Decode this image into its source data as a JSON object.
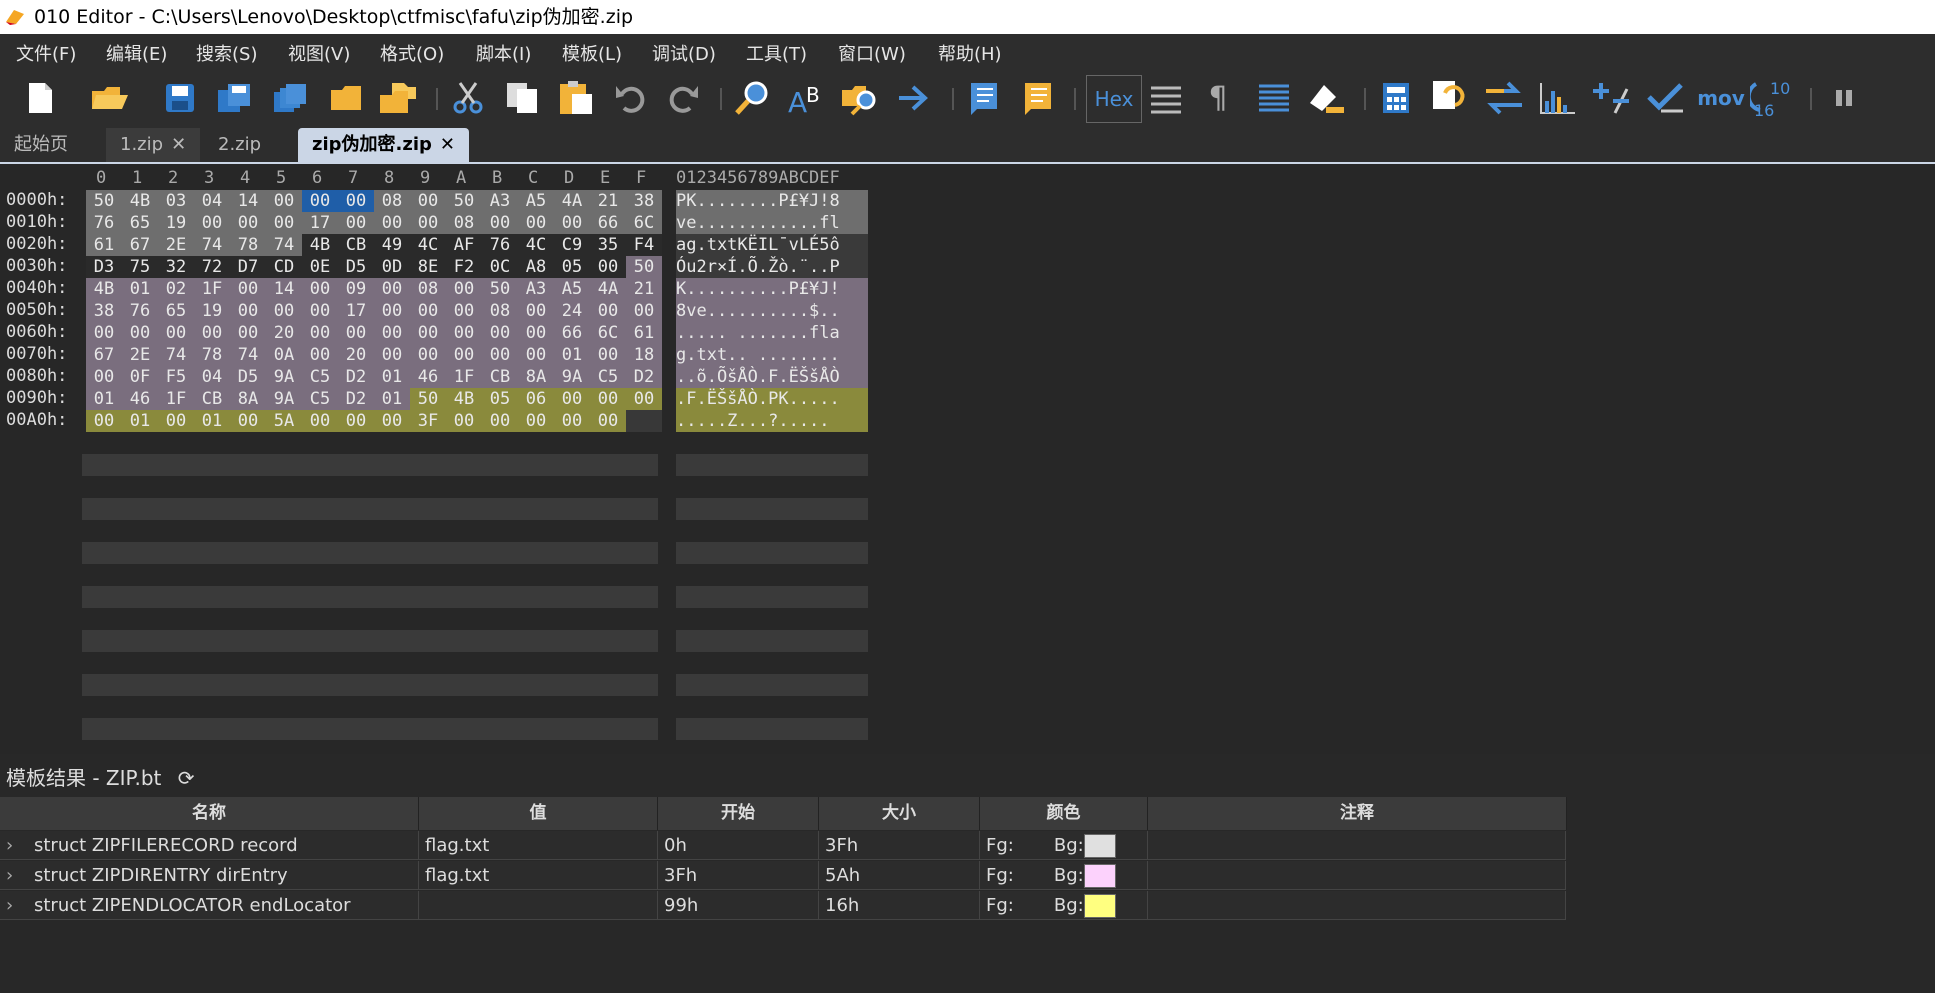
{
  "window": {
    "title": "010 Editor - C:\\Users\\Lenovo\\Desktop\\ctfmisc\\fafu\\zip伪加密.zip"
  },
  "menu": [
    "文件(F)",
    "编辑(E)",
    "搜索(S)",
    "视图(V)",
    "格式(O)",
    "脚本(I)",
    "模板(L)",
    "调试(D)",
    "工具(T)",
    "窗口(W)",
    "帮助(H)"
  ],
  "toolbar": {
    "hex_label": "Hex",
    "mov_label": "mov",
    "base_label_top": "10",
    "base_label_bottom": "16"
  },
  "tabs": [
    {
      "label": "起始页"
    },
    {
      "label": "1.zip"
    },
    {
      "label": "2.zip"
    },
    {
      "label": "zip伪加密.zip"
    }
  ],
  "hex": {
    "column_headers": [
      "0",
      "1",
      "2",
      "3",
      "4",
      "5",
      "6",
      "7",
      "8",
      "9",
      "A",
      "B",
      "C",
      "D",
      "E",
      "F"
    ],
    "ascii_header": "0123456789ABCDEF",
    "rows": [
      {
        "offset": "0000h:",
        "bytes": [
          "50",
          "4B",
          "03",
          "04",
          "14",
          "00",
          "00",
          "00",
          "08",
          "00",
          "50",
          "A3",
          "A5",
          "4A",
          "21",
          "38"
        ],
        "ascii": "PK........P£¥J!8"
      },
      {
        "offset": "0010h:",
        "bytes": [
          "76",
          "65",
          "19",
          "00",
          "00",
          "00",
          "17",
          "00",
          "00",
          "00",
          "08",
          "00",
          "00",
          "00",
          "66",
          "6C"
        ],
        "ascii": "ve............fl"
      },
      {
        "offset": "0020h:",
        "bytes": [
          "61",
          "67",
          "2E",
          "74",
          "78",
          "74",
          "4B",
          "CB",
          "49",
          "4C",
          "AF",
          "76",
          "4C",
          "C9",
          "35",
          "F4"
        ],
        "ascii": "ag.txtKËIL¯vLÉ5ô"
      },
      {
        "offset": "0030h:",
        "bytes": [
          "D3",
          "75",
          "32",
          "72",
          "D7",
          "CD",
          "0E",
          "D5",
          "0D",
          "8E",
          "F2",
          "0C",
          "A8",
          "05",
          "00",
          "50"
        ],
        "ascii": "Óu2r×Í.Õ.Žò.¨..P"
      },
      {
        "offset": "0040h:",
        "bytes": [
          "4B",
          "01",
          "02",
          "1F",
          "00",
          "14",
          "00",
          "09",
          "00",
          "08",
          "00",
          "50",
          "A3",
          "A5",
          "4A",
          "21"
        ],
        "ascii": "K..........P£¥J!"
      },
      {
        "offset": "0050h:",
        "bytes": [
          "38",
          "76",
          "65",
          "19",
          "00",
          "00",
          "00",
          "17",
          "00",
          "00",
          "00",
          "08",
          "00",
          "24",
          "00",
          "00"
        ],
        "ascii": "8ve..........$.."
      },
      {
        "offset": "0060h:",
        "bytes": [
          "00",
          "00",
          "00",
          "00",
          "00",
          "20",
          "00",
          "00",
          "00",
          "00",
          "00",
          "00",
          "00",
          "66",
          "6C",
          "61"
        ],
        "ascii": "..... .......fla"
      },
      {
        "offset": "0070h:",
        "bytes": [
          "67",
          "2E",
          "74",
          "78",
          "74",
          "0A",
          "00",
          "20",
          "00",
          "00",
          "00",
          "00",
          "00",
          "01",
          "00",
          "18"
        ],
        "ascii": "g.txt.. ........"
      },
      {
        "offset": "0080h:",
        "bytes": [
          "00",
          "0F",
          "F5",
          "04",
          "D5",
          "9A",
          "C5",
          "D2",
          "01",
          "46",
          "1F",
          "CB",
          "8A",
          "9A",
          "C5",
          "D2"
        ],
        "ascii": "..õ.ÕšÅÒ.F.ËŠšÅÒ"
      },
      {
        "offset": "0090h:",
        "bytes": [
          "01",
          "46",
          "1F",
          "CB",
          "8A",
          "9A",
          "C5",
          "D2",
          "01",
          "50",
          "4B",
          "05",
          "06",
          "00",
          "00",
          "00"
        ],
        "ascii": ".F.ËŠšÅÒ.PK....."
      },
      {
        "offset": "00A0h:",
        "bytes": [
          "00",
          "01",
          "00",
          "01",
          "00",
          "5A",
          "00",
          "00",
          "00",
          "3F",
          "00",
          "00",
          "00",
          "00",
          "00",
          ""
        ],
        "ascii": ".....Z...?....."
      }
    ]
  },
  "template": {
    "title": "模板结果 - ZIP.bt",
    "headers": [
      "名称",
      "值",
      "开始",
      "大小",
      "颜色",
      "注释"
    ],
    "rows": [
      {
        "name": "struct ZIPFILERECORD record",
        "value": "flag.txt",
        "start": "0h",
        "size": "3Fh",
        "fg": "Fg:",
        "bg": "Bg:",
        "bg_color": "#e0e0e0"
      },
      {
        "name": "struct ZIPDIRENTRY dirEntry",
        "value": "flag.txt",
        "start": "3Fh",
        "size": "5Ah",
        "fg": "Fg:",
        "bg": "Bg:",
        "bg_color": "#fcd2fc"
      },
      {
        "name": "struct ZIPENDLOCATOR endLocator",
        "value": "",
        "start": "99h",
        "size": "16h",
        "fg": "Fg:",
        "bg": "Bg:",
        "bg_color": "#ffff80"
      }
    ]
  },
  "colors": {
    "record": "#6e6e6e",
    "direntry": "#7a6e7e",
    "endloc": "#8a8a3c",
    "selected": "#1f5ea8"
  }
}
